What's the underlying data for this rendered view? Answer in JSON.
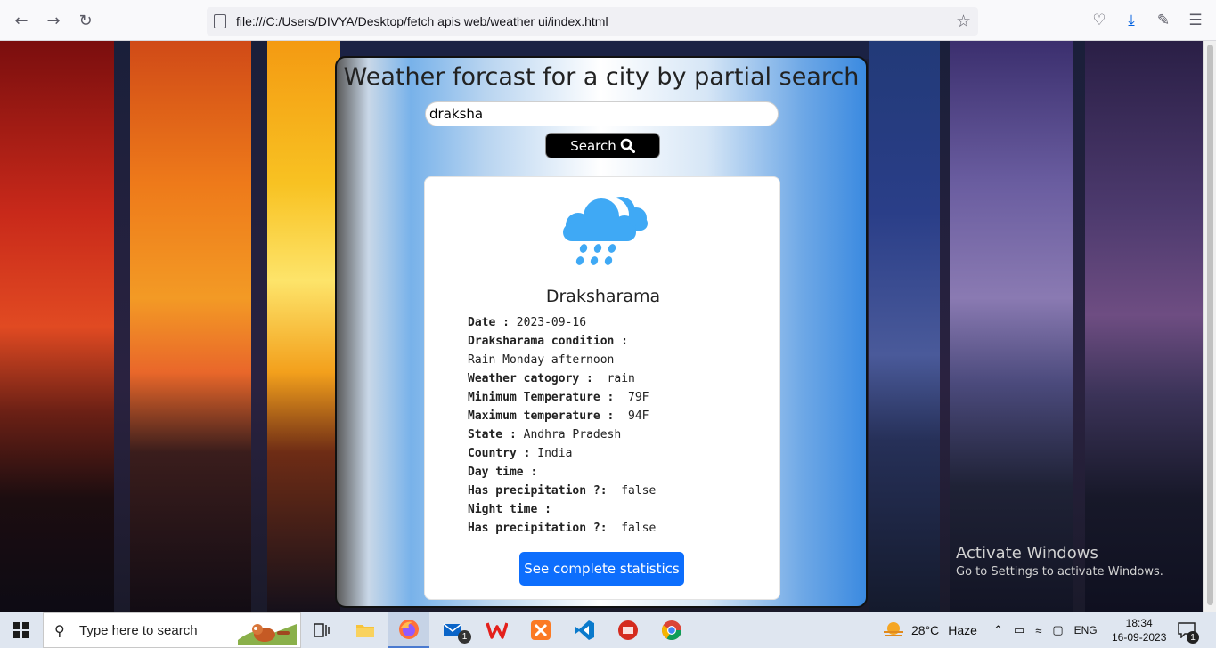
{
  "browser": {
    "url": "file:///C:/Users/DIVYA/Desktop/fetch apis web/weather ui/index.html"
  },
  "page": {
    "title": "Weather forcast for a city by partial search",
    "search_value": "draksha",
    "search_button_label": "Search",
    "city": "Draksharama",
    "details": [
      {
        "label": "Date : ",
        "value": "2023-09-16"
      },
      {
        "label": "Draksharama condition :",
        "value": ""
      },
      {
        "label": "",
        "value": "Rain Monday afternoon"
      },
      {
        "label": "Weather catogory :",
        "value": "  rain"
      },
      {
        "label": "Minimum Temperature :",
        "value": "  79F"
      },
      {
        "label": "Maximum temperature :",
        "value": "  94F"
      },
      {
        "label": "State : ",
        "value": "Andhra Pradesh"
      },
      {
        "label": "Country : ",
        "value": "India"
      },
      {
        "label": "Day time :",
        "value": ""
      },
      {
        "label": "Has precipitation ?:",
        "value": "  false"
      },
      {
        "label": "Night time :",
        "value": ""
      },
      {
        "label": "Has precipitation ?:",
        "value": "  false"
      }
    ],
    "stats_button_label": "See complete statistics"
  },
  "watermark": {
    "line1": "Activate Windows",
    "line2": "Go to Settings to activate Windows."
  },
  "taskbar": {
    "search_placeholder": "Type here to search",
    "mail_badge": "1",
    "weather_temp": "28°C",
    "weather_text": "Haze",
    "lang": "ENG",
    "time": "18:34",
    "date": "16-09-2023",
    "notification_count": "1"
  },
  "colors": {
    "primary_button": "#0d6efd",
    "cloud_blue": "#3fa9f5"
  }
}
